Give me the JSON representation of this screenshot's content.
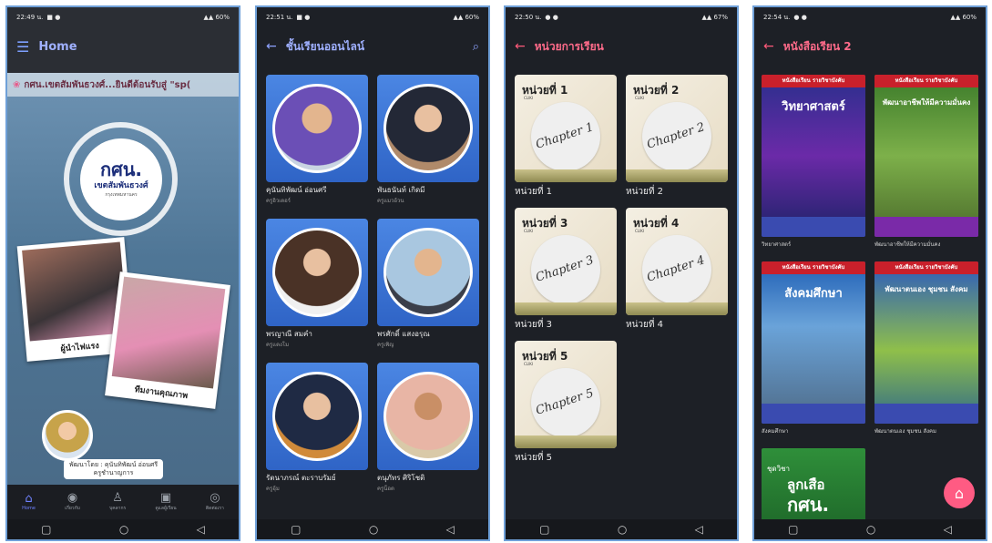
{
  "statusbars": [
    {
      "time": "22:49 น.",
      "right": "60%"
    },
    {
      "time": "22:51 น.",
      "right": "60%"
    },
    {
      "time": "22:50 น.",
      "right": "67%"
    },
    {
      "time": "22:54 น.",
      "right": "60%"
    }
  ],
  "phone1": {
    "title": "Home",
    "marquee": "กศน.เขตสัมพันธวงศ์...ยินดีต้อนรับสู่ \"sp(",
    "logo_big": "กศน.",
    "logo_sub": "เขตสัมพันธวงศ์",
    "logo_small": "กรุงเทพมหานคร",
    "polaroid1_caption": "ผู้นำไฟแรง",
    "polaroid2_caption": "ทีมงานคุณภาพ",
    "credit_line1": "พัฒนาโดย : คุนันทิพัฒน์ อ่อนศรี",
    "credit_line2": "ครูชำนาญการ",
    "bottom_nav": [
      {
        "label": "Home",
        "icon": "home-icon"
      },
      {
        "label": "เกี่ยวกับ",
        "icon": "brain-icon"
      },
      {
        "label": "บุคลากร",
        "icon": "teacher-icon"
      },
      {
        "label": "ดูแลผู้เรียน",
        "icon": "board-icon"
      },
      {
        "label": "ติดต่อเรา",
        "icon": "contact-icon"
      }
    ]
  },
  "phone2": {
    "title": "ชั้นเรียนออนไลน์",
    "teachers": [
      {
        "name": "คุนันทิพัฒน์ อ่อนศรี",
        "nick": "ครูอิวเตอร์"
      },
      {
        "name": "พันธนันท์ เกิดมี",
        "nick": "ครูแมวอ้วน"
      },
      {
        "name": "พรญาณี สมคำ",
        "nick": "ครูแตงโม"
      },
      {
        "name": "พรศักดิ์ แสงอรุณ",
        "nick": "ครูเพิญ"
      },
      {
        "name": "รัตนาภรณ์ ตะราบรัมย์",
        "nick": "ครูอุ้ม"
      },
      {
        "name": "ตนุภัทร ศิริโชติ",
        "nick": "ครูน็อต"
      }
    ]
  },
  "phone3": {
    "title": "หน่วยการเรียน",
    "units": [
      {
        "tag": "หน่วยที่ 1",
        "label": "หน่วยที่ 1",
        "chapter": "Chapter 1"
      },
      {
        "tag": "หน่วยที่ 2",
        "label": "หน่วยที่ 2",
        "chapter": "Chapter 2"
      },
      {
        "tag": "หน่วยที่ 3",
        "label": "หน่วยที่ 3",
        "chapter": "Chapter 3"
      },
      {
        "tag": "หน่วยที่ 4",
        "label": "หน่วยที่ 4",
        "chapter": "Chapter 4"
      },
      {
        "tag": "หน่วยที่ 5",
        "label": "หน่วยที่ 5",
        "chapter": "Chapter 5"
      }
    ],
    "cli": "CLIKI"
  },
  "phone4": {
    "title": "หนังสือเรียน 2",
    "books": [
      {
        "header": "หนังสือเรียน รายวิชาบังคับ",
        "cover_title": "วิทยาศาสตร์",
        "label": "วิทยาศาสตร์"
      },
      {
        "header": "หนังสือเรียน รายวิชาบังคับ",
        "cover_title": "พัฒนาอาชีพให้มีความมั่นคง",
        "label": "พัฒนาอาชีพให้มีความมั่นคง"
      },
      {
        "header": "หนังสือเรียน รายวิชาบังคับ",
        "cover_title": "สังคมศึกษา",
        "label": "สังคมศึกษา"
      },
      {
        "header": "หนังสือเรียน รายวิชาบังคับ",
        "cover_title": "พัฒนาตนเอง ชุมชน สังคม",
        "label": "พัฒนาตนเอง ชุมชน สังคม"
      }
    ],
    "scout_small": "ชุดวิชา",
    "scout_title1": "ลูกเสือ",
    "scout_title2": "กศน.",
    "fab_icon": "home-icon"
  },
  "colors": {
    "accent_blue": "#8fa3ff",
    "accent_pink": "#ff5b83",
    "frame": "#6fa0d8"
  }
}
